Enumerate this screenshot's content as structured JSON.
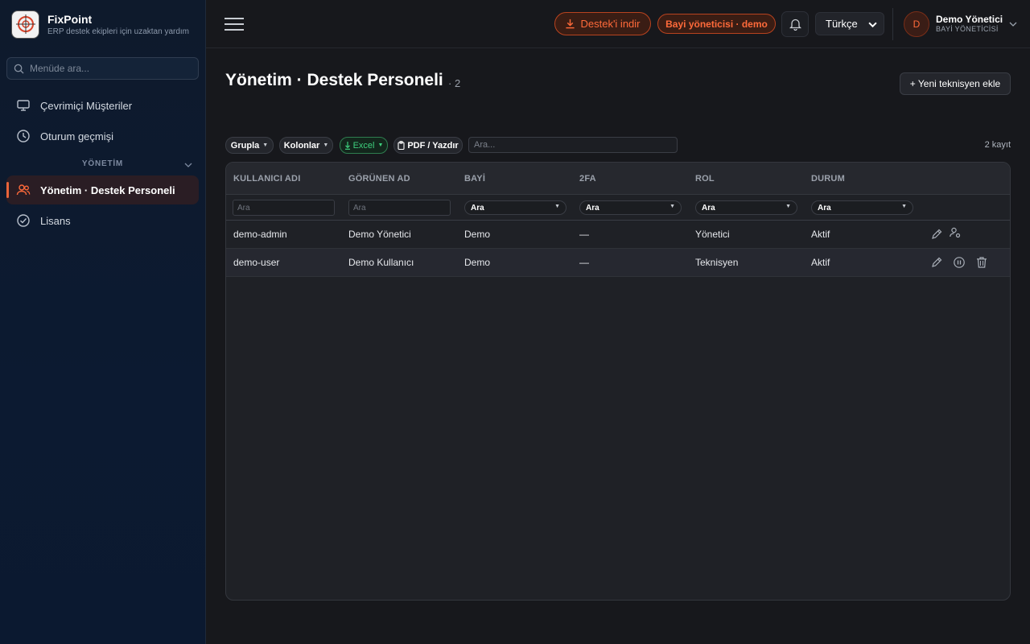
{
  "brand": {
    "name": "FixPoint",
    "subtitle": "ERP destek ekipleri için uzaktan yardım"
  },
  "sidebar": {
    "search_placeholder": "Menüde ara...",
    "items": [
      {
        "label": "Çevrimiçi Müşteriler",
        "icon": "monitor-icon"
      },
      {
        "label": "Oturum geçmişi",
        "icon": "clock-icon"
      },
      {
        "label": "Yönetim · Destek Personeli",
        "icon": "users-icon",
        "active": true
      },
      {
        "label": "Lisans",
        "icon": "check-circle-icon"
      }
    ],
    "section_label": "YÖNETİM"
  },
  "topbar": {
    "download_label": "Destek'i indir",
    "role_badge": "Bayi yöneticisi · demo",
    "language": "Türkçe",
    "user_initial": "D",
    "user_name": "Demo Yönetici",
    "user_role": "BAYİ YÖNETİCİSİ"
  },
  "page": {
    "title": "Yönetim · Destek Personeli",
    "count": "· 2",
    "add_button": "+ Yeni teknisyen ekle"
  },
  "toolbar": {
    "group": "Grupla",
    "columns": "Kolonlar",
    "excel": "Excel",
    "pdf": "PDF / Yazdır",
    "search_placeholder": "Ara...",
    "records": "2 kayıt"
  },
  "table": {
    "headers": [
      "KULLANICI ADI",
      "GÖRÜNEN AD",
      "BAYİ",
      "2FA",
      "ROL",
      "DURUM"
    ],
    "filter_placeholder": "Ara",
    "select_label": "Ara",
    "rows": [
      {
        "username": "demo-admin",
        "display": "Demo Yönetici",
        "dealer": "Demo",
        "twofa": "—",
        "role": "Yönetici",
        "status": "Aktif"
      },
      {
        "username": "demo-user",
        "display": "Demo Kullanıcı",
        "dealer": "Demo",
        "twofa": "—",
        "role": "Teknisyen",
        "status": "Aktif"
      }
    ]
  },
  "colors": {
    "accent": "#ff6a3a",
    "excel_green": "#3ecf7d",
    "background": "#17181c",
    "sidebar": "#0c1a31"
  }
}
